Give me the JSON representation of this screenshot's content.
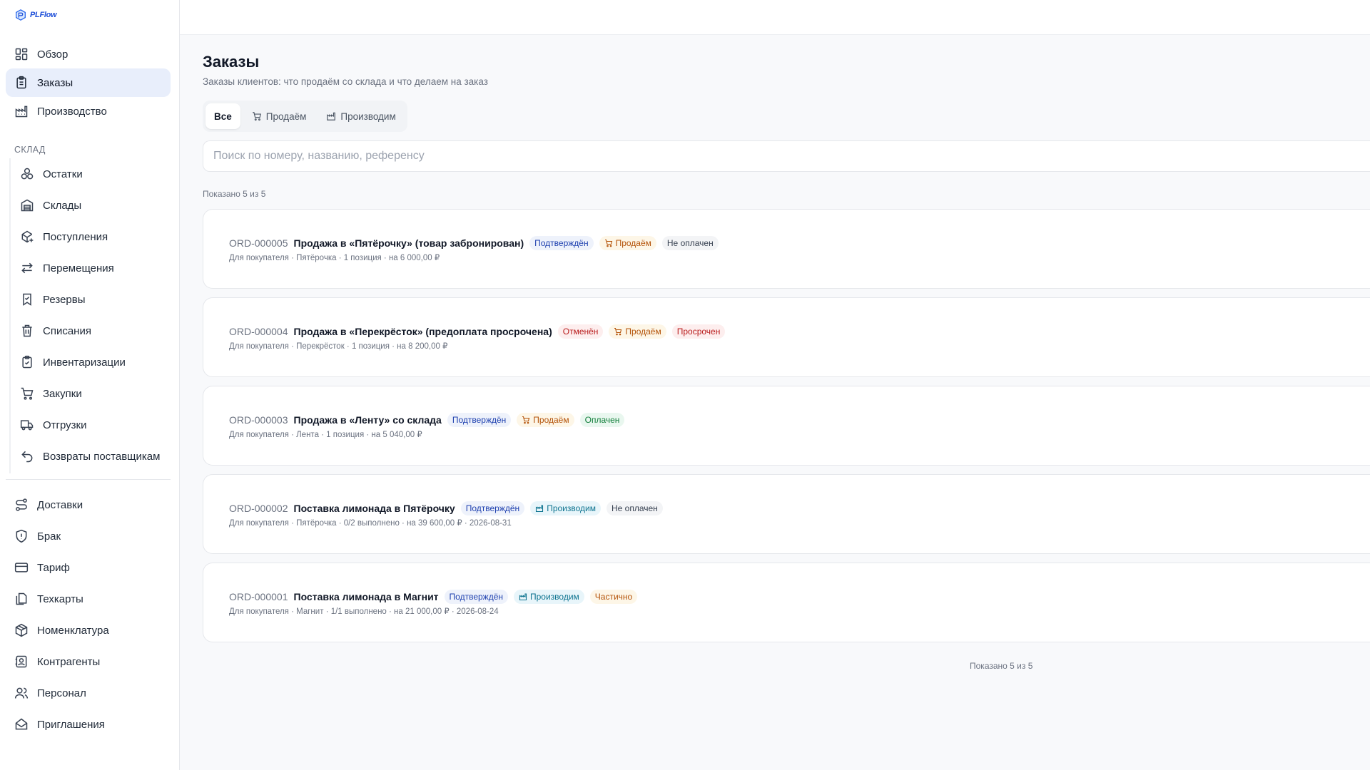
{
  "app": {
    "logo_text": "PLFlow"
  },
  "sidebar": {
    "top_items": [
      {
        "label": "Обзор",
        "icon": "grid-icon",
        "active": false
      },
      {
        "label": "Заказы",
        "icon": "clipboard-list-icon",
        "active": true
      },
      {
        "label": "Производство",
        "icon": "factory-icon",
        "active": false
      }
    ],
    "section_label": "СКЛАД",
    "warehouse_items": [
      {
        "label": "Остатки",
        "icon": "boxes-icon"
      },
      {
        "label": "Склады",
        "icon": "warehouse-icon"
      },
      {
        "label": "Поступления",
        "icon": "package-plus-icon"
      },
      {
        "label": "Перемещения",
        "icon": "arrows-left-right-icon"
      },
      {
        "label": "Резервы",
        "icon": "bookmark-check-icon"
      },
      {
        "label": "Списания",
        "icon": "trash-icon"
      },
      {
        "label": "Инвентаризации",
        "icon": "clipboard-check-icon"
      },
      {
        "label": "Закупки",
        "icon": "cart-icon"
      },
      {
        "label": "Отгрузки",
        "icon": "truck-icon"
      },
      {
        "label": "Возвраты поставщикам",
        "icon": "undo-icon"
      }
    ],
    "bottom_items": [
      {
        "label": "Доставки",
        "icon": "route-icon"
      },
      {
        "label": "Брак",
        "icon": "shield-alert-icon"
      },
      {
        "label": "Тариф",
        "icon": "credit-card-icon"
      },
      {
        "label": "Техкарты",
        "icon": "files-icon"
      },
      {
        "label": "Номенклатура",
        "icon": "package-icon"
      },
      {
        "label": "Контрагенты",
        "icon": "contact-icon"
      },
      {
        "label": "Персонал",
        "icon": "users-icon"
      },
      {
        "label": "Приглашения",
        "icon": "mail-open-icon"
      }
    ]
  },
  "page": {
    "title": "Заказы",
    "subtitle": "Заказы клиентов: что продаём со склада и что делаем на заказ"
  },
  "tabs": [
    {
      "label": "Все",
      "icon": "",
      "active": true
    },
    {
      "label": "Продаём",
      "icon": "cart-icon",
      "active": false
    },
    {
      "label": "Производим",
      "icon": "factory-icon",
      "active": false
    }
  ],
  "search": {
    "placeholder": "Поиск по номеру, названию, референсу",
    "value": ""
  },
  "count_text": "Показано 5 из 5",
  "orders": [
    {
      "id": "ORD-000005",
      "title": "Продажа в «Пятёрочку» (товар забронирован)",
      "badges": [
        {
          "label": "Подтверждён",
          "style": "blue",
          "icon": ""
        },
        {
          "label": "Продаём",
          "style": "amber",
          "icon": "cart-icon"
        },
        {
          "label": "Не оплачен",
          "style": "gray",
          "icon": ""
        }
      ],
      "details": "Для покупателя · Пятёрочка · 1 позиция · на 6 000,00 ₽"
    },
    {
      "id": "ORD-000004",
      "title": "Продажа в «Перекрёсток» (предоплата просрочена)",
      "badges": [
        {
          "label": "Отменён",
          "style": "red",
          "icon": ""
        },
        {
          "label": "Продаём",
          "style": "amber",
          "icon": "cart-icon"
        },
        {
          "label": "Просрочен",
          "style": "red",
          "icon": ""
        }
      ],
      "details": "Для покупателя · Перекрёсток · 1 позиция · на 8 200,00 ₽"
    },
    {
      "id": "ORD-000003",
      "title": "Продажа в «Ленту» со склада",
      "badges": [
        {
          "label": "Подтверждён",
          "style": "blue",
          "icon": ""
        },
        {
          "label": "Продаём",
          "style": "amber",
          "icon": "cart-icon"
        },
        {
          "label": "Оплачен",
          "style": "green",
          "icon": ""
        }
      ],
      "details": "Для покупателя · Лента · 1 позиция · на 5 040,00 ₽"
    },
    {
      "id": "ORD-000002",
      "title": "Поставка лимонада в Пятёрочку",
      "badges": [
        {
          "label": "Подтверждён",
          "style": "blue",
          "icon": ""
        },
        {
          "label": "Производим",
          "style": "cyan",
          "icon": "factory-icon"
        },
        {
          "label": "Не оплачен",
          "style": "gray",
          "icon": ""
        }
      ],
      "details": "Для покупателя · Пятёрочка · 0/2 выполнено · на 39 600,00 ₽ · 2026-08-31"
    },
    {
      "id": "ORD-000001",
      "title": "Поставка лимонада в Магнит",
      "badges": [
        {
          "label": "Подтверждён",
          "style": "blue",
          "icon": ""
        },
        {
          "label": "Производим",
          "style": "cyan",
          "icon": "factory-icon"
        },
        {
          "label": "Частично",
          "style": "amber",
          "icon": ""
        }
      ],
      "details": "Для покупателя · Магнит · 1/1 выполнено · на 21 000,00 ₽ · 2026-08-24"
    }
  ]
}
